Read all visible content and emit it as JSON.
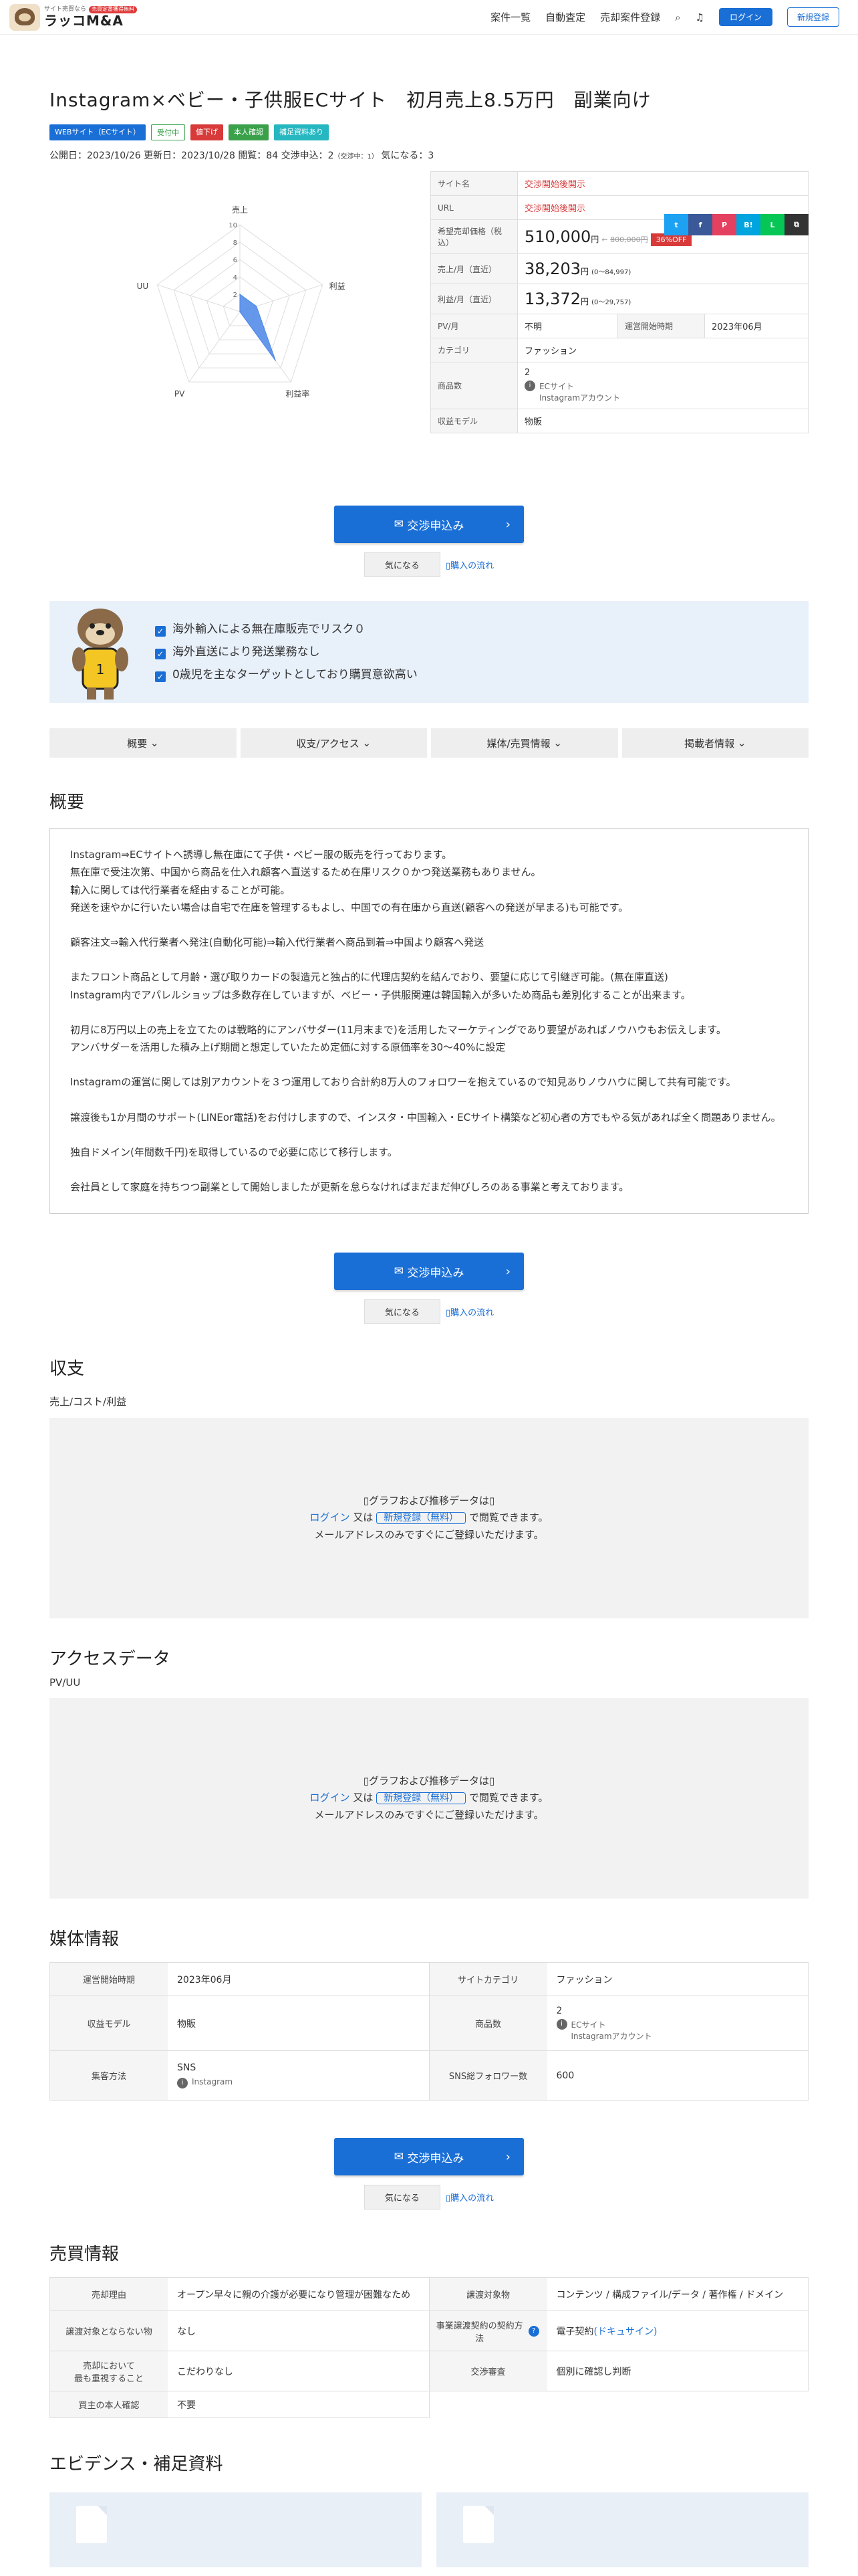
{
  "header": {
    "logo_sub": "サイト売買なら",
    "logo_badge": "売買定番獲得無料",
    "logo_main": "ラッコM&A",
    "nav": [
      "案件一覧",
      "自動査定",
      "売却案件登録"
    ],
    "login": "ログイン",
    "register": "新規登録"
  },
  "title": "Instagram×ベビー・子供服ECサイト　初月売上8.5万円　副業向け",
  "tags": [
    "WEBサイト（ECサイト）",
    "受付中",
    "値下げ",
    "本人確認",
    "補足資料あり"
  ],
  "meta": {
    "published": "公開日：2023/10/26",
    "updated": "更新日：2023/10/28",
    "views": "閲覧：84",
    "negotiations": "交渉申込：2",
    "negotiating": "（交渉中：1）",
    "watch": "気になる：3"
  },
  "radar": {
    "labels": [
      "売上",
      "利益",
      "利益率",
      "PV",
      "UU"
    ],
    "ticks": [
      "10",
      "8",
      "6",
      "4",
      "2"
    ],
    "values": [
      2,
      2,
      7,
      0,
      0
    ],
    "max": 10,
    "color": "#4a86e8"
  },
  "info": {
    "site_name_k": "サイト名",
    "site_name_v": "交渉開始後開示",
    "url_k": "URL",
    "url_v": "交渉開始後開示",
    "price_k": "希望売却価格（税込）",
    "price_v": "510,000",
    "price_unit": "円",
    "price_old": "800,000円",
    "price_off": "36%OFF",
    "sales_k": "売上/月（直近）",
    "sales_v": "38,203",
    "sales_unit": "円",
    "sales_range": "(0〜84,997)",
    "profit_k": "利益/月（直近）",
    "profit_v": "13,372",
    "profit_unit": "円",
    "profit_range": "(0〜29,757)",
    "pv_k": "PV/月",
    "pv_v": "不明",
    "start_k": "運営開始時期",
    "start_v": "2023年06月",
    "cat_k": "カテゴリ",
    "cat_v": "ファッション",
    "products_k": "商品数",
    "products_v": "2",
    "products_sub1": "ECサイト",
    "products_sub2": "Instagramアカウント",
    "model_k": "収益モデル",
    "model_v": "物販"
  },
  "cta": {
    "button": "交渉申込み",
    "watch": "気になる",
    "flow": "購入の流れ"
  },
  "points": [
    "海外輸入による無在庫販売でリスク０",
    "海外直送により発送業務なし",
    "0歳児を主なターゲットとしており購買意欲高い"
  ],
  "tabs": [
    "概要",
    "収支/アクセス",
    "媒体/売買情報",
    "掲載者情報"
  ],
  "overview": {
    "heading": "概要",
    "paragraphs": [
      "Instagram⇒ECサイトへ誘導し無在庫にて子供・ベビー服の販売を行っております。\n無在庫で受注次第、中国から商品を仕入れ顧客へ直送するため在庫リスク０かつ発送業務もありません。\n輸入に関しては代行業者を経由することが可能。\n発送を速やかに行いたい場合は自宅で在庫を管理するもよし、中国での有在庫から直送(顧客への発送が早まる)も可能です。",
      "顧客注文⇒輸入代行業者へ発注(自動化可能)⇒輸入代行業者へ商品到着⇒中国より顧客へ発送",
      "またフロント商品として月齢・選び取りカードの製造元と独占的に代理店契約を結んでおり、要望に応じて引継ぎ可能。(無在庫直送)\nInstagram内でアパレルショップは多数存在していますが、ベビー・子供服関連は韓国輸入が多いため商品も差別化することが出来ます。",
      "初月に8万円以上の売上を立てたのは戦略的にアンバサダー(11月末まで)を活用したマーケティングであり要望があればノウハウもお伝えします。\nアンバサダーを活用した積み上げ期間と想定していたため定価に対する原価率を30〜40%に設定",
      "Instagramの運営に関しては別アカウントを３つ運用しており合計約8万人のフォロワーを抱えているので知見ありノウハウに関して共有可能です。",
      "譲渡後も1か月間のサポート(LINEor電話)をお付けしますので、インスタ・中国輸入・ECサイト構築など初心者の方でもやる気があれば全く問題ありません。",
      "独自ドメイン(年間数千円)を取得しているので必要に応じて移行します。",
      "会社員として家庭を持ちつつ副業として開始しましたが更新を怠らなければまだまだ伸びしろのある事業と考えております。"
    ]
  },
  "finance": {
    "heading": "収支",
    "sub": "売上/コスト/利益"
  },
  "access": {
    "heading": "アクセスデータ",
    "sub": "PV/UU"
  },
  "locked": {
    "line1": "グラフおよび推移データは",
    "login": "ログイン",
    "or": "又は",
    "register": "新規登録（無料）",
    "view": "で閲覧できます。",
    "line3": "メールアドレスのみですぐにご登録いただけます。"
  },
  "media": {
    "heading": "媒体情報",
    "left": [
      {
        "k": "運営開始時期",
        "v": "2023年06月"
      },
      {
        "k": "収益モデル",
        "v": "物販"
      },
      {
        "k": "集客方法",
        "v": "SNS",
        "sub": "Instagram"
      }
    ],
    "right": [
      {
        "k": "サイトカテゴリ",
        "v": "ファッション"
      },
      {
        "k": "商品数",
        "v": "2",
        "sub1": "ECサイト",
        "sub2": "Instagramアカウント"
      },
      {
        "k": "SNS総フォロワー数",
        "v": "600"
      }
    ]
  },
  "trade": {
    "heading": "売買情報",
    "left": [
      {
        "k": "売却理由",
        "v": "オープン早々に親の介護が必要になり管理が困難なため"
      },
      {
        "k": "譲渡対象とならない物",
        "v": "なし"
      },
      {
        "k": "売却において\n最も重視すること",
        "v": "こだわりなし"
      },
      {
        "k": "買主の本人確認",
        "v": "不要"
      }
    ],
    "right": [
      {
        "k": "譲渡対象物",
        "v": "コンテンツ / 構成ファイル/データ / 著作権 / ドメイン"
      },
      {
        "k": "事業譲渡契約の契約方法",
        "v": "電子契約",
        "link": "(ドキュサイン)"
      },
      {
        "k": "交渉審査",
        "v": "個別に確認し判断"
      }
    ]
  },
  "evidence": {
    "heading": "エビデンス・補足資料"
  }
}
